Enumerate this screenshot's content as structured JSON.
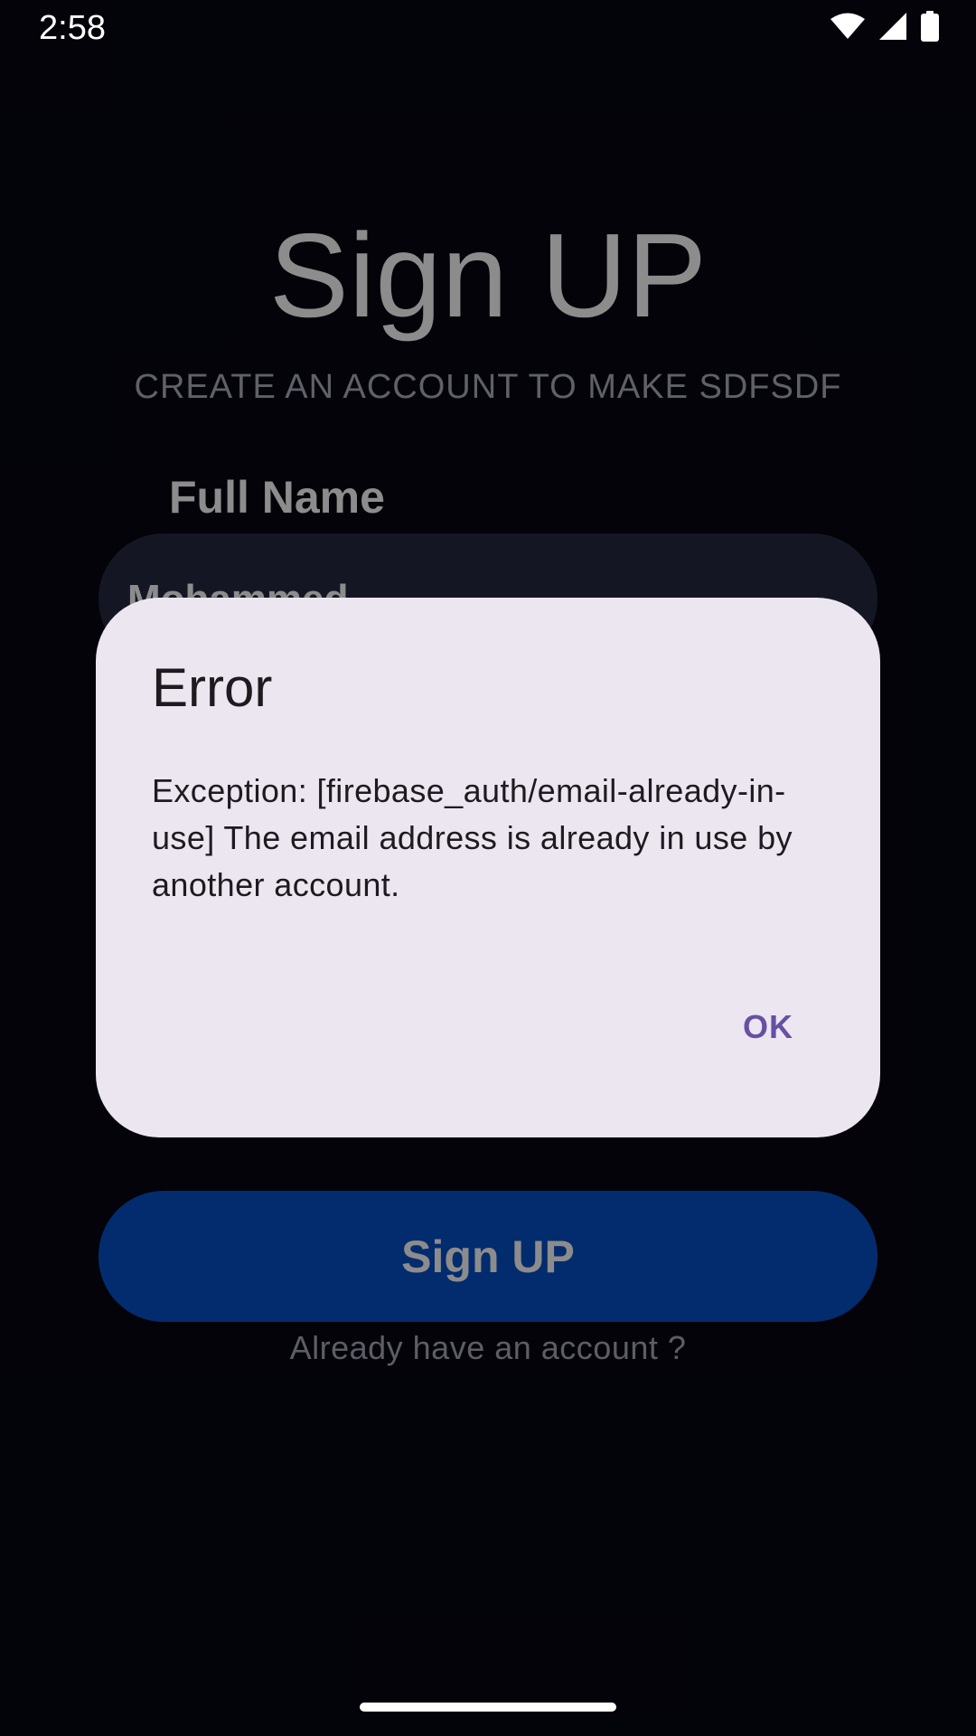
{
  "status_bar": {
    "time": "2:58",
    "icons": [
      "wifi-icon",
      "cell-signal-icon",
      "battery-icon"
    ]
  },
  "signup_screen": {
    "title": "Sign UP",
    "subtitle": "CREATE AN ACCOUNT TO MAKE SDFSDF",
    "full_name_label": "Full Name",
    "full_name_value": "Mohammed",
    "submit_label": "Sign UP",
    "login_link": "Already have an account ?"
  },
  "dialog": {
    "title": "Error",
    "message": "Exception: [firebase_auth/email-already-in-use] The email address is already in use by another account.",
    "ok_label": "OK"
  },
  "colors": {
    "background": "#060712",
    "dialog_surface": "#ece6f0",
    "dialog_text": "#1d1b20",
    "accent": "#6750a4",
    "signup_button": "#0750c9",
    "input_fill": "#262a40"
  }
}
